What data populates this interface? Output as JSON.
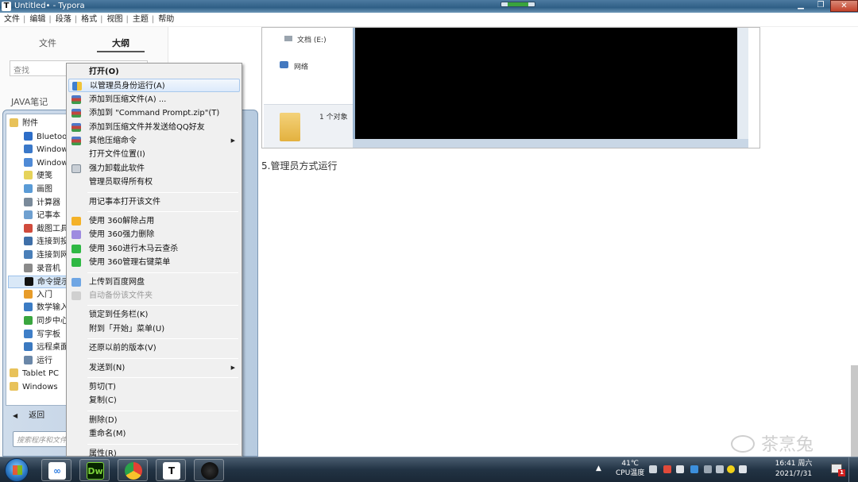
{
  "window": {
    "title": "Untitled• - Typora",
    "app_icon_letter": "T",
    "buttons": {
      "minimize": "▁",
      "maximize": "❐",
      "close": "✕"
    }
  },
  "menubar": [
    "文件",
    "编辑",
    "段落",
    "格式",
    "视图",
    "主题",
    "帮助"
  ],
  "sidepanel": {
    "tabs": {
      "files": "文件",
      "outline": "大纲"
    },
    "search_placeholder": "查找",
    "doc_heading": "JAVA笔记"
  },
  "startmenu": {
    "programs": [
      {
        "label": "附件",
        "folder": true,
        "color": "#e8c25a"
      },
      {
        "label": "Bluetooth",
        "color": "#2d6ec8"
      },
      {
        "label": "Windows",
        "color": "#3a78c9"
      },
      {
        "label": "Windows",
        "color": "#4f8ad6"
      },
      {
        "label": "便笺",
        "color": "#e6d35a"
      },
      {
        "label": "画图",
        "color": "#5a9bd6"
      },
      {
        "label": "计算器",
        "color": "#7a8a9a"
      },
      {
        "label": "记事本",
        "color": "#6fa0d0"
      },
      {
        "label": "截图工具",
        "color": "#d04b3c"
      },
      {
        "label": "连接到投影",
        "color": "#3f6fa8"
      },
      {
        "label": "连接到网络",
        "color": "#4a7fb8"
      },
      {
        "label": "录音机",
        "color": "#8a8a8a"
      },
      {
        "label": "命令提示符",
        "color": "#111111",
        "selected": true
      },
      {
        "label": "入门",
        "color": "#e79c2a"
      },
      {
        "label": "数学输入面",
        "color": "#3b7cc4"
      },
      {
        "label": "同步中心",
        "color": "#3aa63f"
      },
      {
        "label": "写字板",
        "color": "#3f7fc8"
      },
      {
        "label": "远程桌面连",
        "color": "#3b79c0"
      },
      {
        "label": "运行",
        "color": "#6a87a8"
      },
      {
        "label": "Tablet PC",
        "folder": true,
        "color": "#e8c25a"
      },
      {
        "label": "Windows",
        "folder": true,
        "color": "#e8c25a"
      }
    ],
    "back_label": "返回",
    "back_arrow": "◀",
    "search_placeholder": "搜索程序和文件"
  },
  "contextmenu": {
    "items": [
      {
        "label": "打开(O)",
        "bold": true,
        "icon": ""
      },
      {
        "label": "以管理员身份运行(A)",
        "icon": "shield",
        "highlight": true
      },
      {
        "label": "添加到压缩文件(A) ...",
        "icon": "rar"
      },
      {
        "label": "添加到 \"Command Prompt.zip\"(T)",
        "icon": "rar"
      },
      {
        "label": "添加到压缩文件并发送给QQ好友",
        "icon": "rar"
      },
      {
        "label": "其他压缩命令",
        "icon": "rar",
        "submenu": true
      },
      {
        "label": "打开文件位置(I)",
        "icon": ""
      },
      {
        "label": "强力卸载此软件",
        "icon": "trash"
      },
      {
        "label": "管理员取得所有权",
        "icon": ""
      },
      {
        "sep": true
      },
      {
        "label": "用记事本打开该文件",
        "icon": ""
      },
      {
        "sep": true
      },
      {
        "label": "使用 360解除占用",
        "icon": "360a"
      },
      {
        "label": "使用 360强力删除",
        "icon": "360b"
      },
      {
        "label": "使用 360进行木马云查杀",
        "icon": "360c"
      },
      {
        "label": "使用 360管理右键菜单",
        "icon": "360c"
      },
      {
        "sep": true
      },
      {
        "label": "上传到百度网盘",
        "icon": "cloud"
      },
      {
        "label": "自动备份该文件夹",
        "icon": "cloud2",
        "disabled": true
      },
      {
        "sep": true
      },
      {
        "label": "锁定到任务栏(K)",
        "icon": ""
      },
      {
        "label": "附到「开始」菜单(U)",
        "icon": ""
      },
      {
        "sep": true
      },
      {
        "label": "还原以前的版本(V)",
        "icon": ""
      },
      {
        "sep": true
      },
      {
        "label": "发送到(N)",
        "icon": "",
        "submenu": true
      },
      {
        "sep": true
      },
      {
        "label": "剪切(T)",
        "icon": ""
      },
      {
        "label": "复制(C)",
        "icon": ""
      },
      {
        "sep": true
      },
      {
        "label": "删除(D)",
        "icon": ""
      },
      {
        "label": "重命名(M)",
        "icon": ""
      },
      {
        "sep": true
      },
      {
        "label": "属性(R)",
        "icon": ""
      }
    ],
    "submenu_arrow": "▶"
  },
  "document": {
    "explorer": {
      "drive_label": "文档 (E:)",
      "network_label": "网络",
      "count_label": "1 个对象"
    },
    "caption": "5.管理员方式运行"
  },
  "watermark": "茶烹兔",
  "taskbar": {
    "apps": [
      {
        "name": "baidu-netdisk",
        "glyph": "∞"
      },
      {
        "name": "dreamweaver",
        "glyph": "Dw"
      },
      {
        "name": "chrome",
        "glyph": ""
      },
      {
        "name": "typora",
        "glyph": "T"
      },
      {
        "name": "cmd",
        "glyph": ""
      }
    ],
    "tray": {
      "temperature": "41℃",
      "temp_label": "CPU温度",
      "time": "16:41 周六",
      "date": "2021/7/31",
      "notify_count": "1"
    }
  }
}
